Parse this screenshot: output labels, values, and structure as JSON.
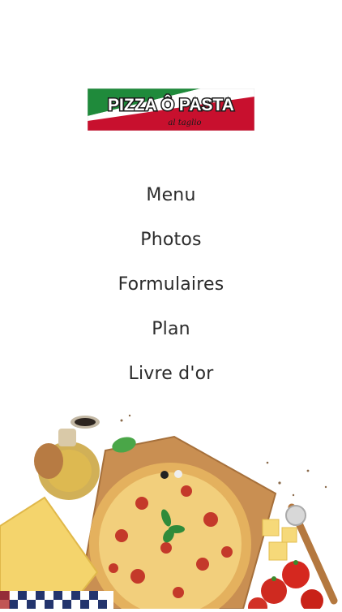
{
  "logo": {
    "title": "PIZZA Ô PASTA",
    "subtitle": "al taglio",
    "colors": {
      "green": "#1f8a3b",
      "white": "#ffffff",
      "red": "#c8102e"
    }
  },
  "menu": {
    "items": [
      {
        "label": "Menu"
      },
      {
        "label": "Photos"
      },
      {
        "label": "Formulaires"
      },
      {
        "label": "Plan"
      },
      {
        "label": "Livre d'or"
      }
    ]
  }
}
